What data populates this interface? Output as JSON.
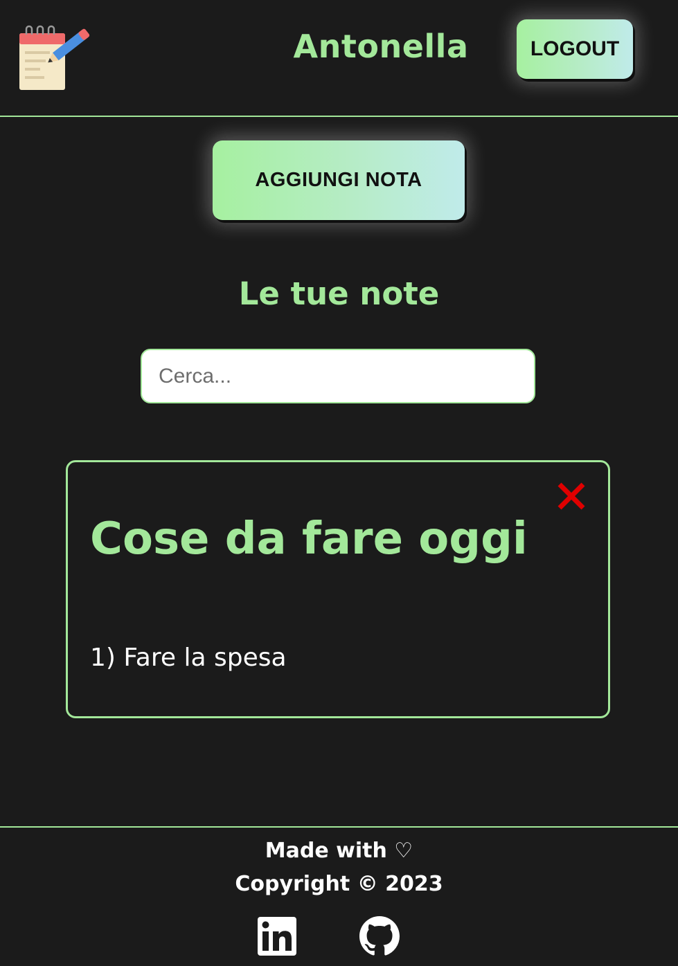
{
  "header": {
    "logo_icon": "notepad-pencil-icon",
    "username": "Antonella",
    "logout_label": "LOGOUT"
  },
  "main": {
    "add_note_label": "AGGIUNGI NOTA",
    "section_title": "Le tue note",
    "search": {
      "placeholder": "Cerca...",
      "value": ""
    },
    "notes": [
      {
        "title": "Cose da fare oggi",
        "body": "1) Fare la spesa",
        "delete_icon": "close-icon"
      }
    ]
  },
  "footer": {
    "made_with": "Made with ♡",
    "copyright": "Copyright © 2023",
    "social": [
      {
        "icon": "linkedin-icon"
      },
      {
        "icon": "github-icon"
      }
    ]
  },
  "colors": {
    "background": "#1b1b1b",
    "accent": "#a3e89a",
    "button_gradient_start": "#a6f0a0",
    "button_gradient_end": "#c0ebea",
    "delete": "#e00000",
    "text": "#ffffff"
  }
}
